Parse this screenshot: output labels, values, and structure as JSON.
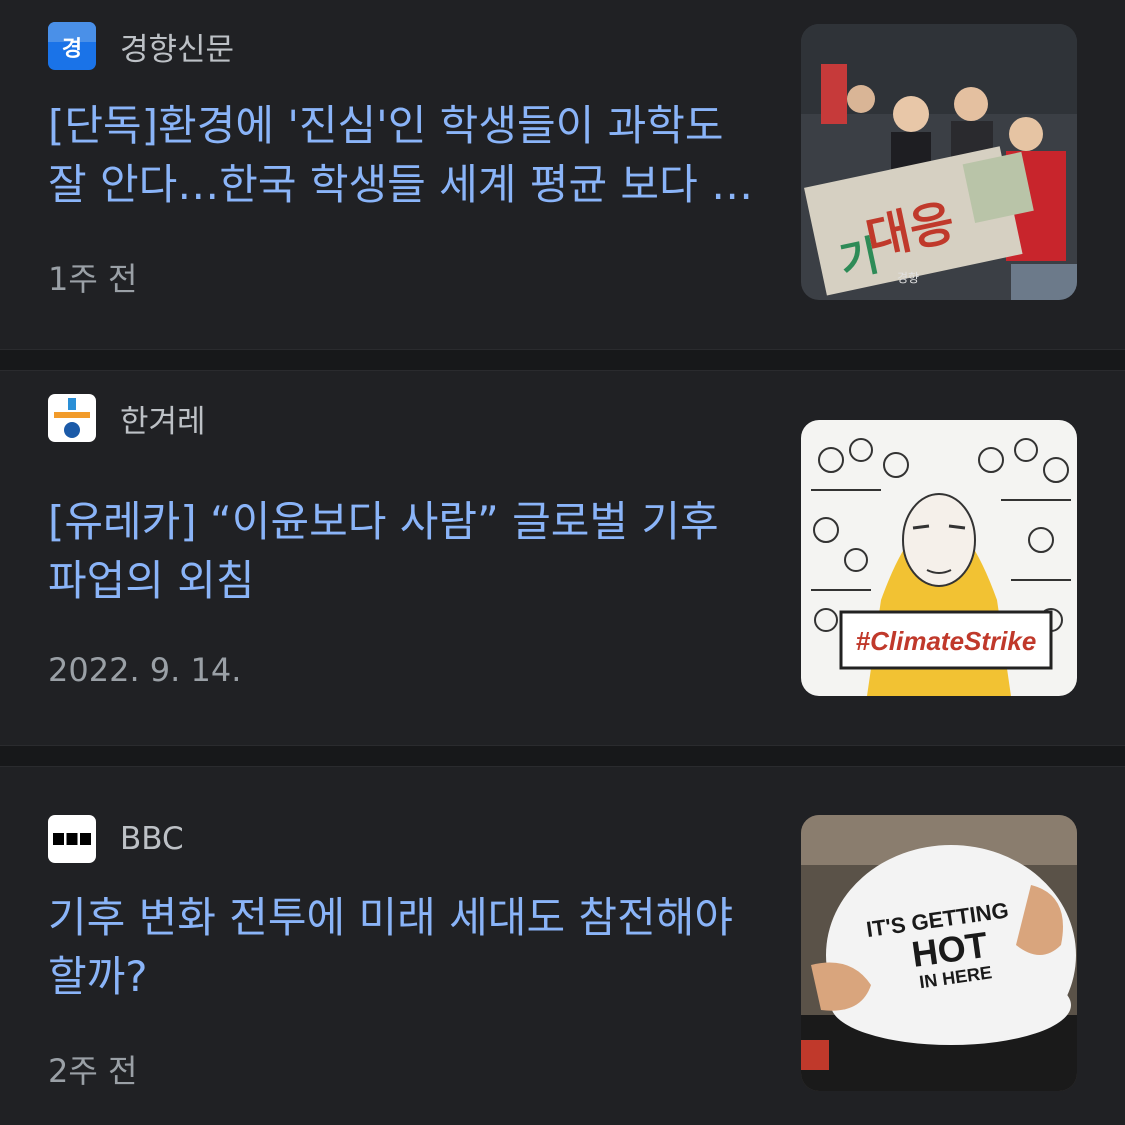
{
  "articles": [
    {
      "source": "경향신문",
      "logo_icon": "kyunghyang-logo-icon",
      "headline": "[단독]환경에 '진심'인 학생들이 과학도 잘 안다…한국 학생들 세계 평균 보다 높아",
      "time": "1주 전",
      "thumbnail": "students-climate-protest-photo",
      "thumbnail_sign_text": "대응",
      "thumbnail_watermark": "경향"
    },
    {
      "source": "한겨레",
      "logo_icon": "hankyoreh-logo-icon",
      "headline": "[유레카] “이윤보다 사람” 글로벌 기후 파업의 외침",
      "time": "2022. 9. 14.",
      "thumbnail": "climate-strike-illustration",
      "thumbnail_banner_text": "#ClimateStrike"
    },
    {
      "source": "BBC",
      "logo_icon": "bbc-logo-icon",
      "headline": "기후 변화 전투에 미래 세대도 참전해야 할까?",
      "time": "2주 전",
      "thumbnail": "pregnant-belly-shirt-photo",
      "thumbnail_shirt_text": [
        "IT'S GETTING",
        "HOT",
        "IN HERE"
      ]
    }
  ],
  "colors": {
    "background": "#202124",
    "divider": "#17181a",
    "headline": "#8ab4f8",
    "source": "#bdc1c6",
    "timestamp": "#9aa0a6"
  }
}
